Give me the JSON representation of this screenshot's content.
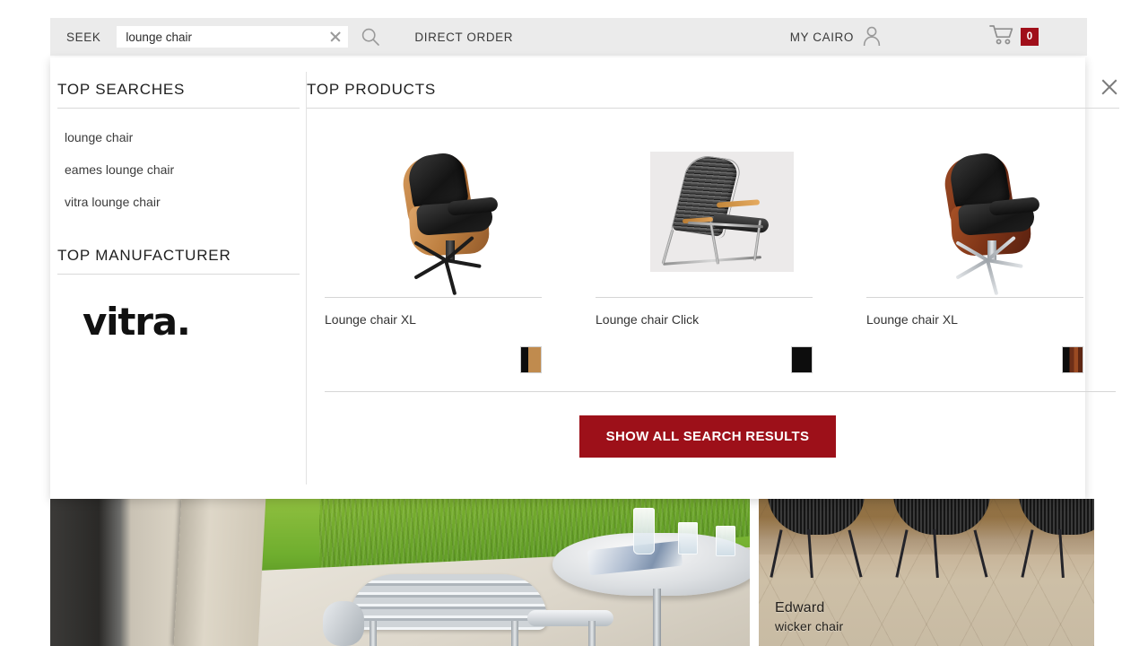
{
  "header": {
    "seek_label": "SEEK",
    "search_value": "lounge chair",
    "search_placeholder": "lounge chair",
    "clear_icon": "close-icon",
    "search_icon": "search-icon",
    "direct_order_label": "DIRECT ORDER",
    "account_label": "MY CAIRO",
    "account_icon": "user-icon",
    "cart_icon": "shopping-cart-icon",
    "cart_count": "0",
    "cart_badge_color": "#a00f1a",
    "header_bg_color": "#ebebeb"
  },
  "panel": {
    "close_icon": "close-icon",
    "left": {
      "top_searches_title": "TOP SEARCHES",
      "searches": [
        {
          "label": "lounge chair"
        },
        {
          "label": "eames lounge chair"
        },
        {
          "label": "vitra lounge chair"
        }
      ],
      "top_manufacturer_title": "TOP MANUFACTURER",
      "manufacturer_logo_text": "vitra."
    },
    "right": {
      "top_products_title": "TOP PRODUCTS",
      "products": [
        {
          "name": "Lounge chair XL",
          "image_alt": "eames-lounge-chair-light-wood",
          "swatch": {
            "name": "black-and-light-wood-swatch",
            "colors": [
              "#0d0d0d",
              "#c08b4e"
            ]
          }
        },
        {
          "name": "Lounge chair Click",
          "image_alt": "click-lounge-chair-steel-frame",
          "swatch": {
            "name": "black-swatch",
            "colors": [
              "#0d0d0d"
            ]
          }
        },
        {
          "name": "Lounge chair XL",
          "image_alt": "eames-lounge-chair-rosewood",
          "swatch": {
            "name": "black-and-rosewood-swatch",
            "colors": [
              "#0d0d0d",
              "#7a3418"
            ]
          }
        }
      ],
      "cta_label": "SHOW ALL SEARCH RESULTS",
      "cta_color": "#9d1019"
    }
  },
  "background": {
    "left_tile": {
      "alt": "outdoor-patio-with-aluminium-chairs-and-table"
    },
    "right_tile": {
      "alt": "black-wicker-chairs-on-paving",
      "caption_line1": "Edward",
      "caption_line2": "wicker chair"
    }
  }
}
